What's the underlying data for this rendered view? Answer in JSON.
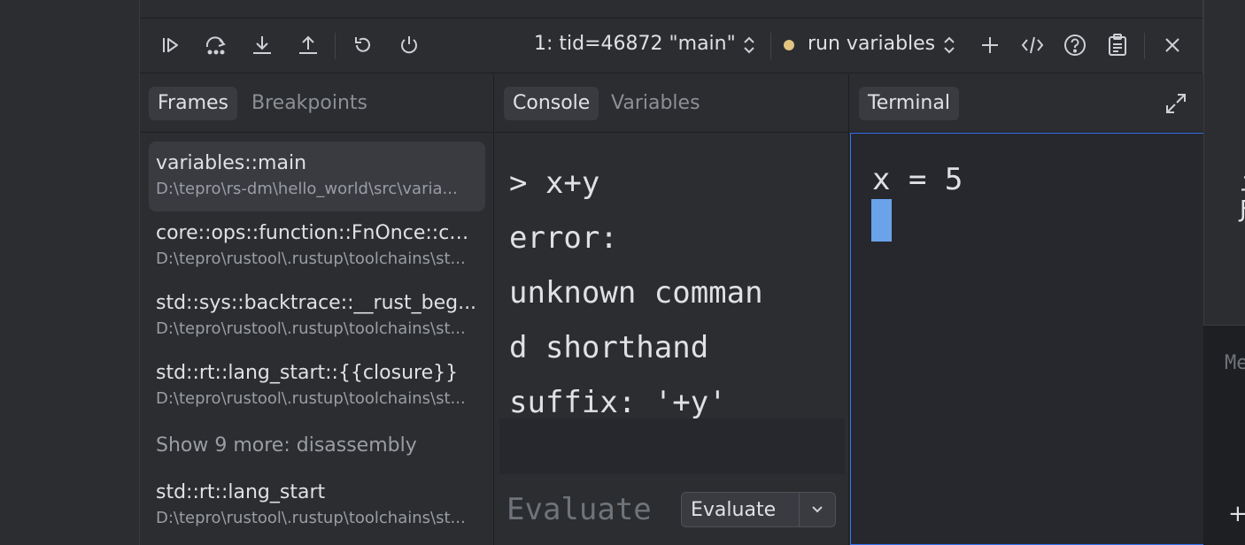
{
  "toolbar": {
    "thread_label": "1: tid=46872 \"main\"",
    "config_label": "run variables",
    "config_dot_color": "#e0c47f"
  },
  "frames_panel": {
    "tabs": [
      "Frames",
      "Breakpoints"
    ],
    "frames": [
      {
        "fn": "variables::main",
        "path": "D:\\tepro\\rs-dm\\hello_world\\src\\varia..."
      },
      {
        "fn": "core::ops::function::FnOnce::ca...",
        "path": "D:\\tepro\\rustool\\.rustup\\toolchains\\st..."
      },
      {
        "fn": "std::sys::backtrace::__rust_beg...",
        "path": "D:\\tepro\\rustool\\.rustup\\toolchains\\st..."
      },
      {
        "fn": "std::rt::lang_start::{{closure}}",
        "path": "D:\\tepro\\rustool\\.rustup\\toolchains\\st..."
      }
    ],
    "show_more": "Show 9 more: disassembly",
    "last_frame": {
      "fn": "std::rt::lang_start",
      "path": "D:\\tepro\\rustool\\.rustup\\toolchains\\st..."
    }
  },
  "console_panel": {
    "tabs": [
      "Console",
      "Variables"
    ],
    "output_lines": [
      "> x+y",
      "error:",
      "unknown comman",
      "d shorthand",
      "suffix: '+y'"
    ],
    "eval_placeholder": "Evaluate",
    "eval_button": "Evaluate"
  },
  "terminal_panel": {
    "tab": "Terminal",
    "text": "x = 5"
  },
  "right_edge": {
    "glyph_1": "ユ",
    "glyph_2": "Ƒ",
    "mono_text": "Me"
  }
}
